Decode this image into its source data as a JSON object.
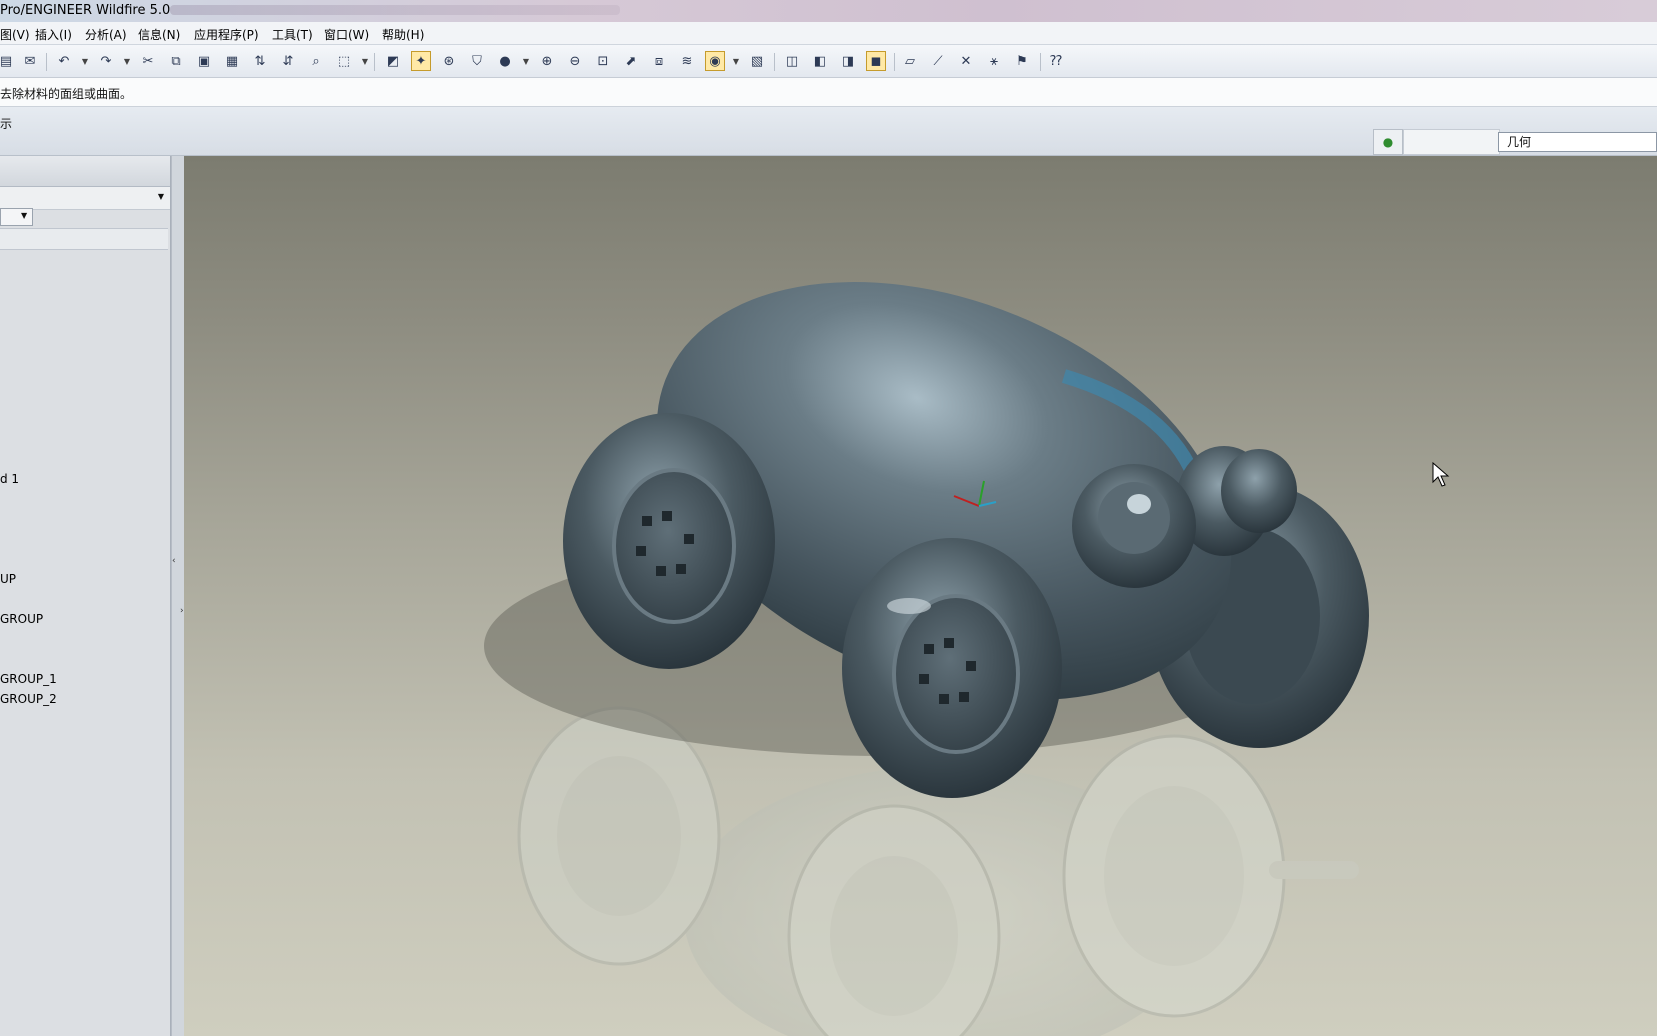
{
  "window": {
    "title": "Pro/ENGINEER Wildfire 5.0"
  },
  "menu": {
    "items": [
      "图(V)",
      "插入(I)",
      "分析(A)",
      "信息(N)",
      "应用程序(P)",
      "工具(T)",
      "窗口(W)",
      "帮助(H)"
    ]
  },
  "message": {
    "text": "去除材料的面组或曲面。"
  },
  "status": {
    "left_text": "示",
    "filter_label": "几何"
  },
  "tree": {
    "items": [
      "d 1",
      "UP",
      "GROUP",
      "GROUP_1",
      "GROUP_2"
    ]
  },
  "colors": {
    "model_body": "#4e5d66",
    "model_highlight": "#9fb2bc",
    "model_accent": "#3e88ad",
    "viewport_top": "#7c7c70",
    "viewport_bottom": "#cfcebf"
  }
}
